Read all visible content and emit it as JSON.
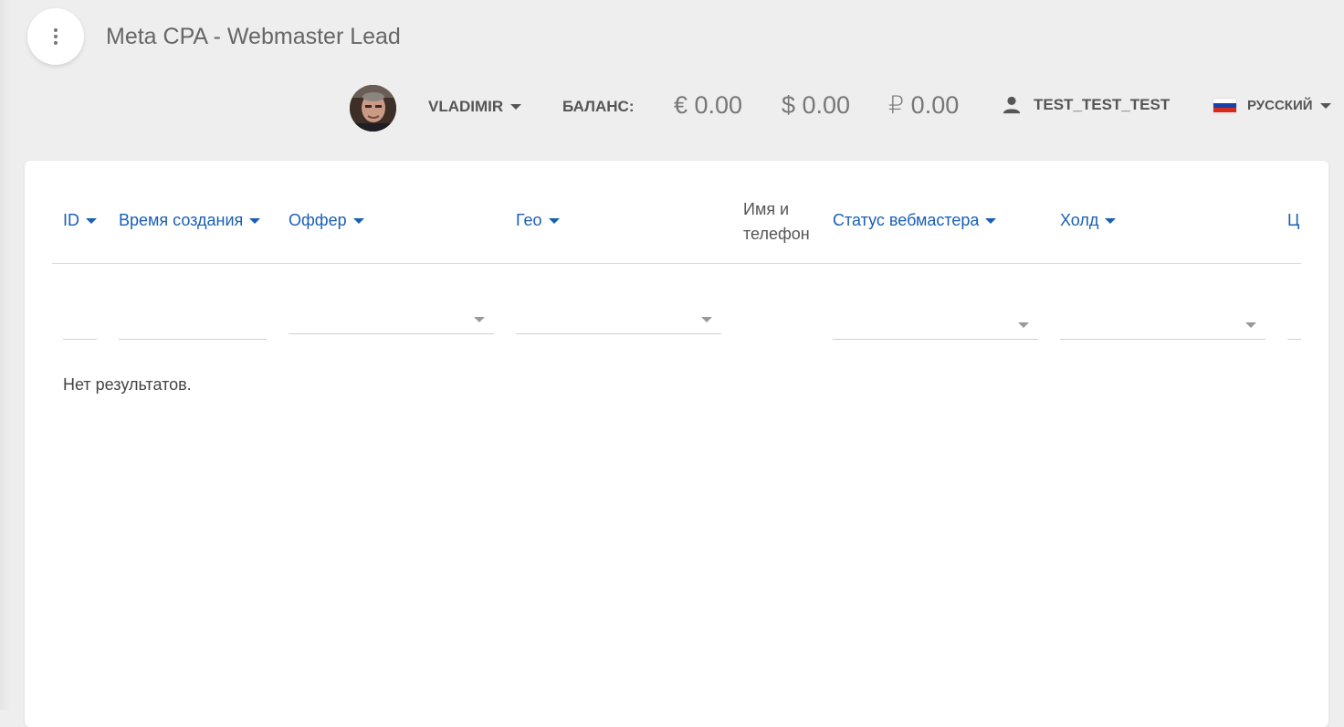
{
  "header": {
    "title": "Meta CPA - Webmaster Lead"
  },
  "topbar": {
    "user_name": "VLADIMIR",
    "balance_label": "БАЛАНС:",
    "balances": [
      "€ 0.00",
      "$ 0.00",
      "₽ 0.00"
    ],
    "account": "TEST_TEST_TEST",
    "language": "РУССКИЙ"
  },
  "table": {
    "columns": [
      {
        "label": "ID"
      },
      {
        "label": "Время создания"
      },
      {
        "label": "Оффер"
      },
      {
        "label": "Гео"
      },
      {
        "label": "Имя и телефон"
      },
      {
        "label": "Статус вебмастера"
      },
      {
        "label": "Холд"
      },
      {
        "label": "Ц"
      }
    ],
    "empty_text": "Нет результатов."
  },
  "colors": {
    "accent": "#1a5fb4",
    "background": "#eeeeee",
    "card": "#ffffff"
  },
  "icons": [
    "more-vertical-icon",
    "caret-down-icon",
    "person-icon",
    "russian-flag-icon",
    "avatar-photo"
  ]
}
